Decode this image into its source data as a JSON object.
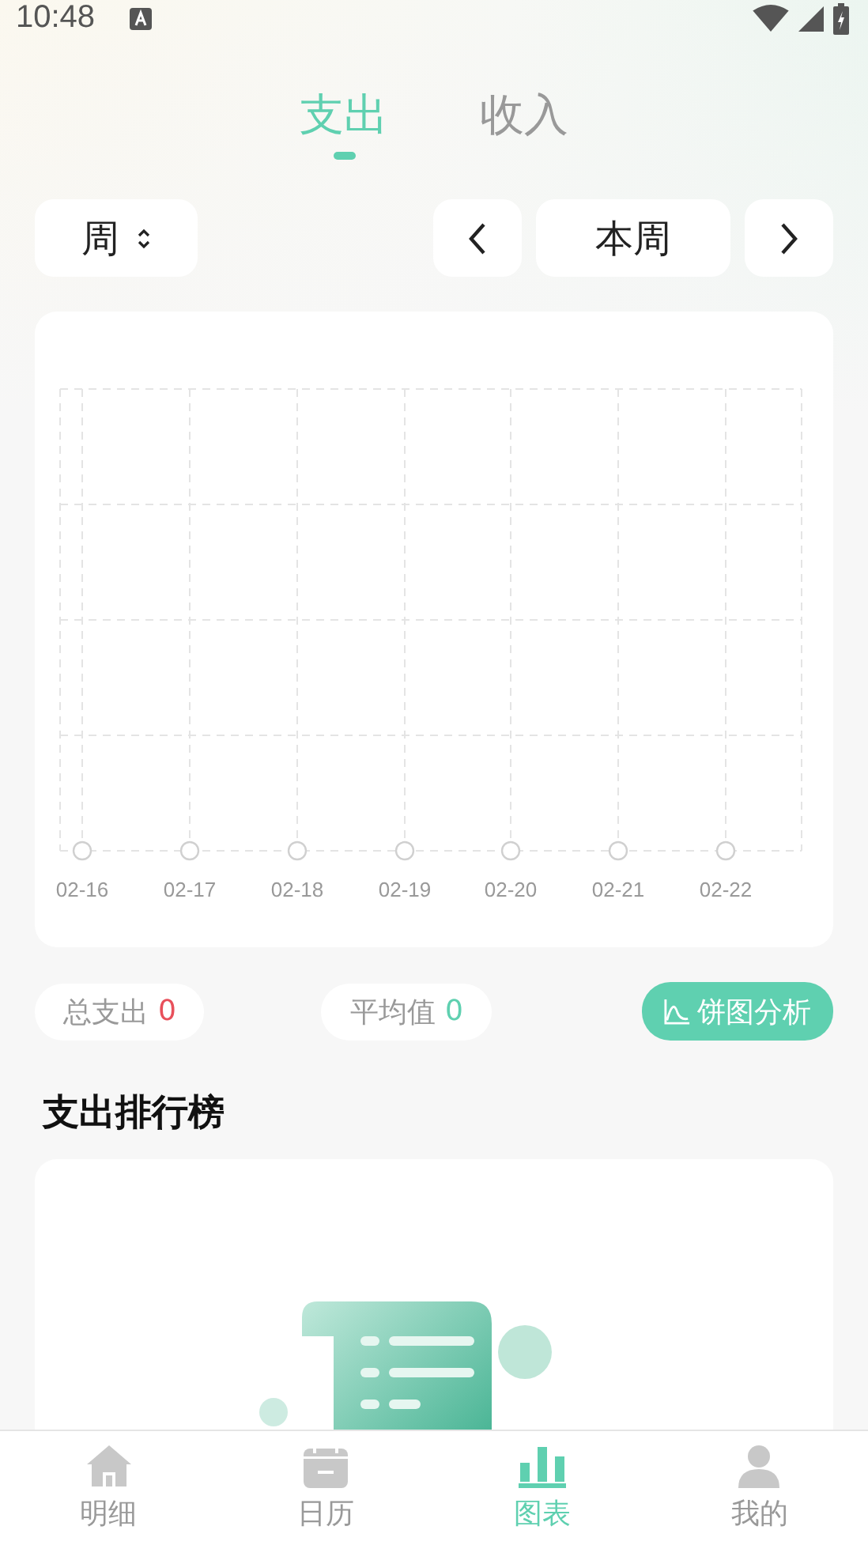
{
  "status_bar": {
    "time": "10:48"
  },
  "tabs": [
    {
      "label": "支出",
      "selected": true
    },
    {
      "label": "收入",
      "selected": false
    }
  ],
  "period_select": {
    "value": "周"
  },
  "period_nav": {
    "current": "本周"
  },
  "chart": {
    "x_labels": [
      "02-16",
      "02-17",
      "02-18",
      "02-19",
      "02-20",
      "02-21",
      "02-22"
    ]
  },
  "stats": [
    {
      "label": "总支出",
      "value": "0",
      "color": "#e8505b"
    },
    {
      "label": "平均值",
      "value": "0",
      "color": "#5fd0b0"
    }
  ],
  "pie_button": {
    "label": "饼图分析"
  },
  "ranking": {
    "title": "支出排行榜"
  },
  "bottom_nav": [
    {
      "label": "明细",
      "selected": false
    },
    {
      "label": "日历",
      "selected": false
    },
    {
      "label": "图表",
      "selected": true
    },
    {
      "label": "我的",
      "selected": false
    }
  ]
}
